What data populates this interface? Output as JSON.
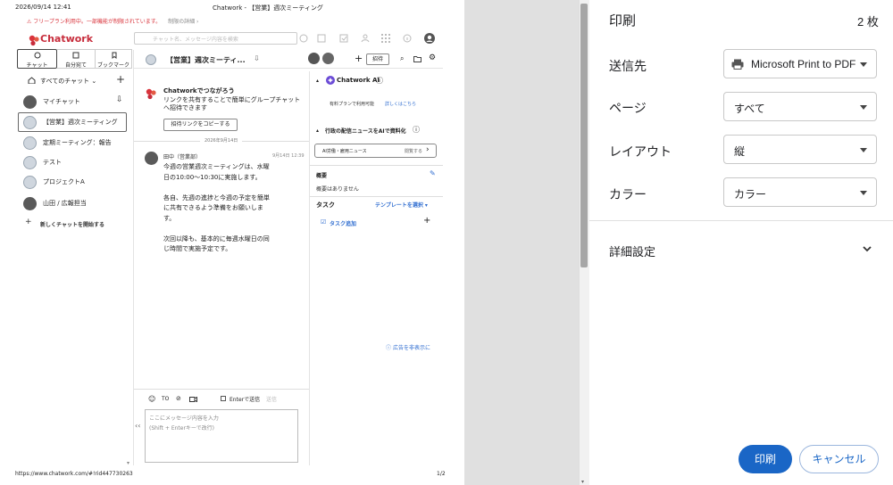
{
  "sheet": {
    "header_datetime": "2026/09/14 12:41",
    "header_title": "Chatwork - 【営業】週次ミーティング",
    "footer_url": "https://www.chatwork.com/#!rid447730263",
    "footer_page": "1/2",
    "banner": {
      "text": "フリープラン利用中。一部機能が制限されています。",
      "link": "制限の詳細 ›"
    },
    "brand": "Chatwork",
    "search_placeholder": "チャット名、メッセージ内容を検索",
    "nav_tabs": [
      {
        "label": "チャット",
        "icon": "chat-icon"
      },
      {
        "label": "自分宛て",
        "icon": "mention-icon"
      },
      {
        "label": "ブックマーク",
        "icon": "bookmark-icon"
      }
    ],
    "all_chats_label": "すべてのチャット",
    "chat_list": [
      {
        "name": "マイチャット"
      },
      {
        "name": "【営業】週次ミーティング"
      },
      {
        "name": "定期ミーティング：報告"
      },
      {
        "name": "テスト"
      },
      {
        "name": "プロジェクトA"
      },
      {
        "name": "山田 / 広報担当"
      }
    ],
    "new_chat_label": "新しくチャットを開始する",
    "room_title": "【営業】週次ミーティ...",
    "invite_label": "招待",
    "connect": {
      "title": "Chatworkでつながろう",
      "body1": "リンクを共有することで簡単にグループチャット",
      "body2": "へ招待できます",
      "button": "招待リンクをコピーする"
    },
    "date_divider": "2026年9月14日",
    "message": {
      "sender": "田中（営業部）",
      "time": "9月14日 12:39",
      "lines": [
        "今週の営業週次ミーティングは、水曜",
        "日の10:00～10:30に実施します。",
        "",
        "各自、先週の進捗と今週の予定を簡単",
        "に共有できるよう準備をお願いしま",
        "す。",
        "",
        "次回以降も、基本的に毎週水曜日の同",
        "じ時間で実施予定です。"
      ]
    },
    "composer": {
      "enter_label": "Enterで送信",
      "send_label": "送信",
      "placeholder1": "ここにメッセージ内容を入力",
      "placeholder2": "(Shift + Enterキーで改行)",
      "to_label": "TO"
    },
    "ai": {
      "title": "Chatwork AI",
      "paid_text": "有料プランで利用可能",
      "paid_link": "詳しくはこちら",
      "news_title": "行政の配信ニュースをAIで資料化",
      "news_item": "AI労働・雇用ニュース",
      "news_action": "閲覧する"
    },
    "summary": {
      "title": "概要",
      "empty": "概要はありません"
    },
    "task": {
      "title": "タスク",
      "template": "テンプレートを選択",
      "add": "タスク追加"
    },
    "hide_ad": "広告を非表示に"
  },
  "print": {
    "title": "印刷",
    "sheet_count": "2 枚",
    "fields": [
      {
        "label": "送信先",
        "value": "Microsoft Print to PDF",
        "icon": "printer-icon"
      },
      {
        "label": "ページ",
        "value": "すべて"
      },
      {
        "label": "レイアウト",
        "value": "縦"
      },
      {
        "label": "カラー",
        "value": "カラー"
      }
    ],
    "advanced": "詳細設定",
    "print_button": "印刷",
    "cancel_button": "キャンセル"
  },
  "colors": {
    "accent": "#1a66c6",
    "brand": "#d9343c",
    "gutter": "#e0e0e0",
    "link": "#2f6dd0"
  }
}
